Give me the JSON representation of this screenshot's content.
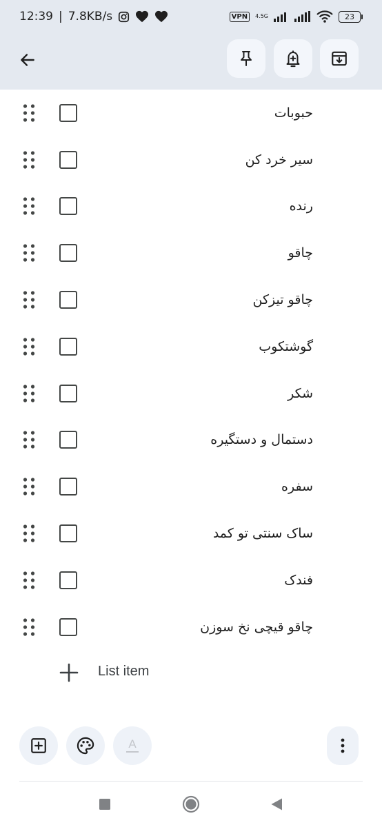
{
  "status_bar": {
    "time": "12:39",
    "separator": "|",
    "speed": "7.8KB/s",
    "vpn": "VPN",
    "network": "4.5G",
    "battery": "23"
  },
  "toolbar": {
    "back": "back-arrow-icon",
    "pin": "pin-icon",
    "reminder": "bell-plus-icon",
    "archive": "archive-icon"
  },
  "list": {
    "items": [
      {
        "text": "حبوبات",
        "checked": false
      },
      {
        "text": "سیر خرد کن",
        "checked": false
      },
      {
        "text": "رنده",
        "checked": false
      },
      {
        "text": "چاقو",
        "checked": false
      },
      {
        "text": "چاقو تیزکن",
        "checked": false
      },
      {
        "text": "گوشتکوب",
        "checked": false
      },
      {
        "text": "شکر",
        "checked": false
      },
      {
        "text": "دستمال و دستگیره",
        "checked": false
      },
      {
        "text": "سفره",
        "checked": false
      },
      {
        "text": "ساک سنتی تو کمد",
        "checked": false
      },
      {
        "text": "فندک",
        "checked": false
      },
      {
        "text": "چاقو قیچی نخ سوزن",
        "checked": false
      }
    ],
    "add_label": "List item"
  },
  "bottom_bar": {
    "add": "add-box-icon",
    "palette": "palette-icon",
    "text_format": "A",
    "more": "more-vert-icon"
  },
  "colors": {
    "header_bg": "#e4e9f0",
    "button_bg": "#f3f6fb",
    "icon": "#1f1f1f"
  }
}
